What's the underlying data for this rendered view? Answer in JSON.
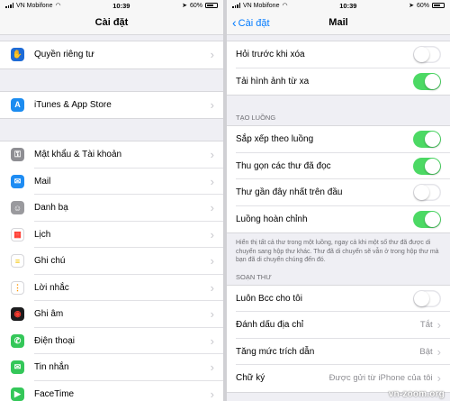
{
  "left": {
    "status": {
      "carrier": "VN Mobifone",
      "time": "10:39",
      "battery": "60%"
    },
    "nav": {
      "title": "Cài đặt"
    },
    "groups": [
      [
        {
          "label": "Quyền riêng tư",
          "icon": "hand-icon",
          "color": "#1e6bd6"
        }
      ],
      [
        {
          "label": "iTunes & App Store",
          "icon": "app-store-icon",
          "color": "#1c8cf0"
        }
      ],
      [
        {
          "label": "Mật khẩu & Tài khoản",
          "icon": "key-icon",
          "color": "#8e8e93"
        },
        {
          "label": "Mail",
          "icon": "mail-icon",
          "color": "#1e8cf3"
        },
        {
          "label": "Danh bạ",
          "icon": "contacts-icon",
          "color": "#9a9a9e"
        },
        {
          "label": "Lịch",
          "icon": "calendar-icon",
          "color": "#ffffff"
        },
        {
          "label": "Ghi chú",
          "icon": "notes-icon",
          "color": "#ffffff"
        },
        {
          "label": "Lời nhắc",
          "icon": "reminders-icon",
          "color": "#ffffff"
        },
        {
          "label": "Ghi âm",
          "icon": "voice-memos-icon",
          "color": "#1c1c1e"
        },
        {
          "label": "Điện thoại",
          "icon": "phone-icon",
          "color": "#34c759"
        },
        {
          "label": "Tin nhắn",
          "icon": "messages-icon",
          "color": "#34c759"
        },
        {
          "label": "FaceTime",
          "icon": "facetime-icon",
          "color": "#34c759"
        }
      ]
    ]
  },
  "right": {
    "status": {
      "carrier": "VN Mobifone",
      "time": "10:39",
      "battery": "60%"
    },
    "nav": {
      "title": "Mail",
      "back": "Cài đặt"
    },
    "group1": [
      {
        "label": "Hỏi trước khi xóa",
        "toggle": false
      },
      {
        "label": "Tải hình ảnh từ xa",
        "toggle": true
      }
    ],
    "threading": {
      "header": "TẠO LUỒNG",
      "rows": [
        {
          "label": "Sắp xếp theo luồng",
          "toggle": true
        },
        {
          "label": "Thu gọn các thư đã đọc",
          "toggle": true
        },
        {
          "label": "Thư gần đây nhất trên đầu",
          "toggle": false
        },
        {
          "label": "Luồng hoàn chỉnh",
          "toggle": true
        }
      ],
      "footnote": "Hiển thị tất cả thư trong một luồng, ngay cả khi một số thư đã được di chuyển sang hộp thư khác. Thư đã di chuyển sẽ vẫn ở trong hộp thư mà bạn đã di chuyển chúng đến đó."
    },
    "composing": {
      "header": "SOẠN THƯ",
      "rows": [
        {
          "label": "Luôn Bcc cho tôi",
          "toggle": false
        },
        {
          "label": "Đánh dấu địa chỉ",
          "value": "Tắt"
        },
        {
          "label": "Tăng mức trích dẫn",
          "value": "Bật"
        },
        {
          "label": "Chữ ký",
          "value": "Được gửi từ iPhone của tôi"
        }
      ]
    }
  },
  "watermark": "vn-zoom.org"
}
